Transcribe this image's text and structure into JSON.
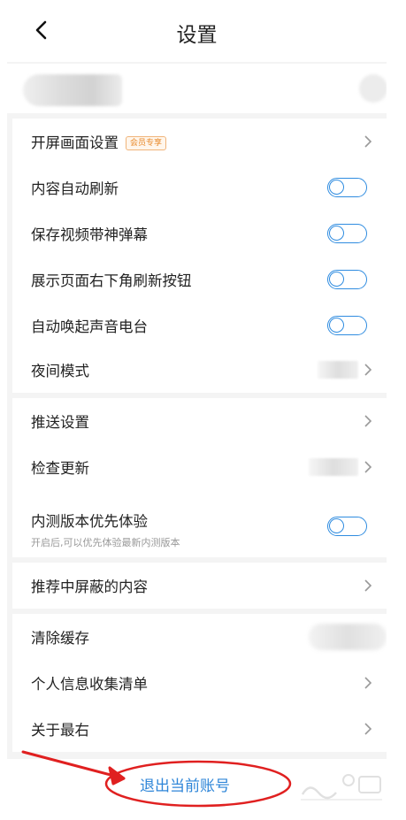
{
  "header": {
    "title": "设置",
    "back_icon": "chevron-left-icon"
  },
  "sections": [
    {
      "rows": [
        {
          "label": "开屏画面设置",
          "badge": "会员专享",
          "control": "chevron"
        },
        {
          "label": "内容自动刷新",
          "control": "toggle",
          "on": false
        },
        {
          "label": "保存视频带神弹幕",
          "control": "toggle",
          "on": false
        },
        {
          "label": "展示页面右下角刷新按钮",
          "control": "toggle",
          "on": false
        },
        {
          "label": "自动唤起声音电台",
          "control": "toggle",
          "on": false
        },
        {
          "label": "夜间模式",
          "control": "chevron"
        }
      ]
    },
    {
      "rows": [
        {
          "label": "推送设置",
          "control": "chevron"
        },
        {
          "label": "检查更新",
          "control": "chevron"
        },
        {
          "label": "内测版本优先体验",
          "sublabel": "开启后,可以优先体验最新内测版本",
          "control": "toggle",
          "on": false
        }
      ]
    },
    {
      "rows": [
        {
          "label": "推荐中屏蔽的内容",
          "control": "chevron"
        }
      ]
    },
    {
      "rows": [
        {
          "label": "清除缓存"
        },
        {
          "label": "个人信息收集清单",
          "control": "chevron"
        },
        {
          "label": "关于最右",
          "control": "chevron"
        }
      ]
    }
  ],
  "logout": {
    "label": "退出当前账号"
  },
  "annotation": {
    "color": "#e02020"
  },
  "colors": {
    "accent": "#2f8ce0",
    "badge": "#e8892a",
    "background": "#f4f4f4"
  }
}
